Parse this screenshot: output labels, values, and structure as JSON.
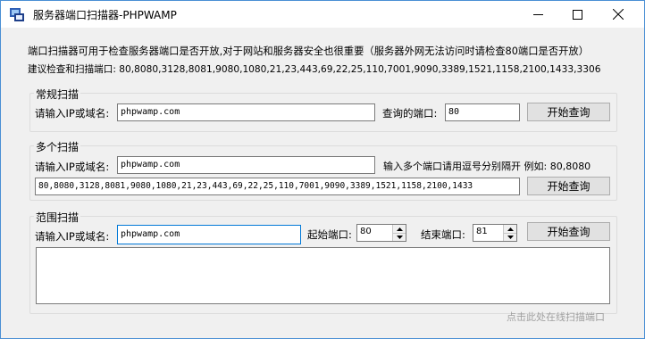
{
  "window": {
    "title": "服务器端口扫描器-PHPWAMP"
  },
  "intro": {
    "line1": "端口扫描器可用于检查服务器端口是否开放,对于网站和服务器安全也很重要（服务器外网无法访问时请检查80端口是否开放）",
    "line2": "建议检查和扫描端口: 80,8080,3128,8081,9080,1080,21,23,443,69,22,25,110,7001,9090,3389,1521,1158,2100,1433,3306"
  },
  "single_scan": {
    "legend": "常规扫描",
    "host_label": "请输入IP或域名:",
    "host_value": "phpwamp.com",
    "port_label": "查询的端口:",
    "port_value": "80",
    "button": "开始查询"
  },
  "multi_scan": {
    "legend": "多个扫描",
    "host_label": "请输入IP或域名:",
    "host_value": "phpwamp.com",
    "hint": "输入多个端口请用逗号分别隔开  例如: 80,8080",
    "ports_value": "80,8080,3128,8081,9080,1080,21,23,443,69,22,25,110,7001,9090,3389,1521,1158,2100,1433",
    "button": "开始查询"
  },
  "range_scan": {
    "legend": "范围扫描",
    "host_label": "请输入IP或域名:",
    "host_value": "phpwamp.com",
    "start_label": "起始端口:",
    "start_value": "80",
    "end_label": "结束端口:",
    "end_value": "81",
    "button": "开始查询"
  },
  "footer": {
    "link": "点击此处在线扫描端口"
  },
  "icons": [
    "app-icon",
    "minimize-icon",
    "maximize-icon",
    "close-icon",
    "spin-up-icon",
    "spin-down-icon"
  ]
}
